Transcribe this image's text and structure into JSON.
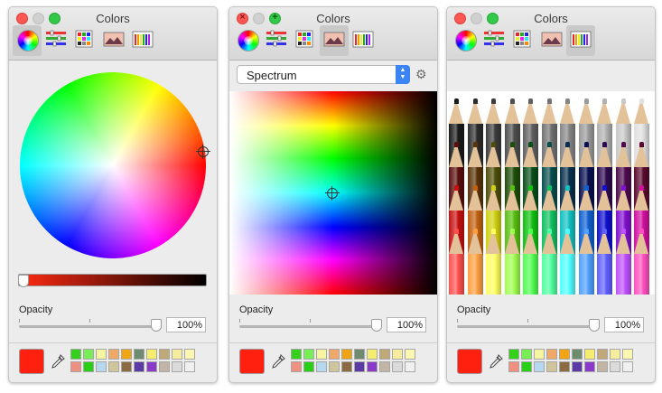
{
  "windows": [
    {
      "title": "Colors",
      "mode": "wheel",
      "opacity_label": "Opacity",
      "opacity_value": "100%",
      "opacity_fraction": 1.0,
      "brightness_fraction": 0.0,
      "current_color": "#ff2010"
    },
    {
      "title": "Colors",
      "mode": "spectrum",
      "popup_value": "Spectrum",
      "opacity_label": "Opacity",
      "opacity_value": "100%",
      "opacity_fraction": 1.0,
      "current_color": "#ff2010"
    },
    {
      "title": "Colors",
      "mode": "pencils",
      "opacity_label": "Opacity",
      "opacity_value": "100%",
      "opacity_fraction": 1.0,
      "current_color": "#ff2010"
    }
  ],
  "toolbar_tabs": [
    "color-wheel-icon",
    "color-sliders-icon",
    "color-palettes-icon",
    "image-palettes-icon",
    "pencils-icon"
  ],
  "swatches": [
    "#33d11a",
    "#77ee55",
    "#f5f5a0",
    "#f0a868",
    "#f2a412",
    "#6e8b70",
    "#f6ec6e",
    "#c0a878",
    "#f5ec9c",
    "#fbf7b0",
    "#f09080",
    "#27d015",
    "#b6d8ef",
    "#cfc59b",
    "#8c6a42",
    "#5b3aa6",
    "#8a3ac8",
    "#c2b5a6",
    "#dbdbdb",
    "#f0f0f0"
  ],
  "pencil_colors": [
    [
      "#1a1a1a",
      "#2c2c2c",
      "#3c3c3c",
      "#4e4e4e",
      "#606060",
      "#727272",
      "#868686",
      "#9a9a9a",
      "#b0b0b0",
      "#c8c8c8",
      "#e0e0e0"
    ],
    [
      "#5a0e0e",
      "#5a3308",
      "#4e4e08",
      "#1f4e08",
      "#084e1a",
      "#084e4e",
      "#08304e",
      "#0a1050",
      "#2e0a50",
      "#4e0a4e",
      "#5a0a2e"
    ],
    [
      "#c61010",
      "#c06010",
      "#d0d010",
      "#58c010",
      "#10c010",
      "#10c060",
      "#10c0c0",
      "#1060d0",
      "#1010d0",
      "#8010d0",
      "#d010a0"
    ],
    [
      "#ff5050",
      "#ffa040",
      "#ffff60",
      "#a0ff50",
      "#50ff50",
      "#50ffa0",
      "#50ffff",
      "#50a0ff",
      "#6060ff",
      "#c050ff",
      "#ff50c0"
    ]
  ]
}
